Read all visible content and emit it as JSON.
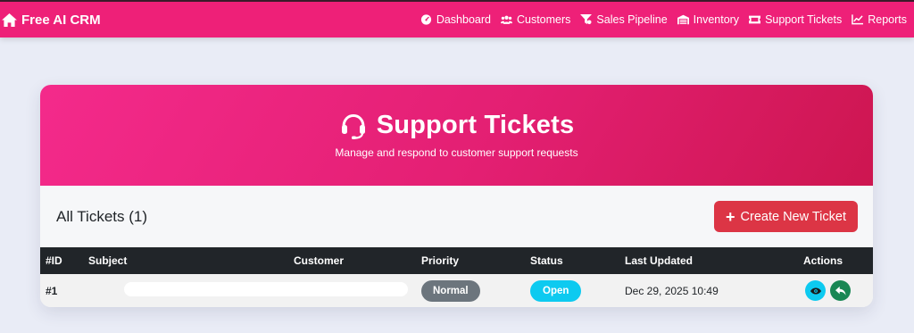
{
  "brand": {
    "name": "Free AI CRM",
    "icon": "home-icon"
  },
  "nav": {
    "items": [
      {
        "label": "Dashboard",
        "icon": "dashboard-gauge-icon"
      },
      {
        "label": "Customers",
        "icon": "users-icon"
      },
      {
        "label": "Sales Pipeline",
        "icon": "funnel-icon"
      },
      {
        "label": "Inventory",
        "icon": "warehouse-icon"
      },
      {
        "label": "Support Tickets",
        "icon": "ticket-icon"
      },
      {
        "label": "Reports",
        "icon": "chart-line-icon"
      }
    ]
  },
  "hero": {
    "title": "Support Tickets",
    "subtitle": "Manage and respond to customer support requests",
    "icon": "headset-icon"
  },
  "toolbar": {
    "heading": "All Tickets (1)",
    "create_label": "Create New Ticket"
  },
  "table": {
    "headers": [
      "#ID",
      "Subject",
      "Customer",
      "Priority",
      "Status",
      "Last Updated",
      "Actions"
    ],
    "rows": [
      {
        "id": "#1",
        "priority": "Normal",
        "status": "Open",
        "updated": "Dec 29, 2025 10:49"
      }
    ]
  },
  "colors": {
    "accent": "#ee2078",
    "danger": "#dc3545",
    "info": "#0dcaf0",
    "success": "#198754",
    "secondary": "#6c757d",
    "dark": "#212529"
  }
}
